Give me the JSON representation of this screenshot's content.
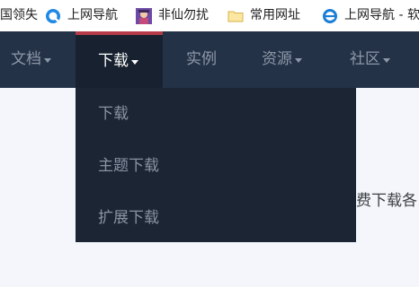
{
  "bookmarks": [
    {
      "label": "国领失",
      "icon": "none"
    },
    {
      "label": "上网导航",
      "icon": "blue-q-icon"
    },
    {
      "label": "非仙勿扰",
      "icon": "avatar-icon"
    },
    {
      "label": "常用网址",
      "icon": "folder-icon"
    },
    {
      "label": "上网导航 - 软",
      "icon": "ie-icon"
    }
  ],
  "nav": [
    {
      "label": "文档",
      "dropdown": true
    },
    {
      "label": "下载",
      "dropdown": true,
      "active": true
    },
    {
      "label": "实例",
      "dropdown": false
    },
    {
      "label": "资源",
      "dropdown": true
    },
    {
      "label": "社区",
      "dropdown": true
    }
  ],
  "dropdown": [
    "下载",
    "主题下载",
    "扩展下载"
  ],
  "main": {
    "partial_text": "费下载各"
  },
  "colors": {
    "navbar": "#243247",
    "active_tab": "#17212f",
    "active_border": "#b53b48",
    "dropdown": "#1b2533",
    "page_bg": "#f4f6fb"
  }
}
